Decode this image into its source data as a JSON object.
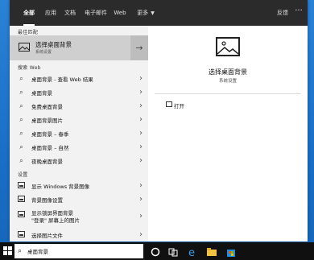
{
  "tabs": [
    {
      "label": "全部",
      "active": true
    },
    {
      "label": "应用",
      "active": false
    },
    {
      "label": "文档",
      "active": false
    },
    {
      "label": "电子邮件",
      "active": false
    },
    {
      "label": "Web",
      "active": false
    },
    {
      "label": "更多",
      "active": false
    }
  ],
  "more_caret": "▼",
  "feedback_label": "反馈",
  "more_options_icon": "···",
  "best_match": {
    "section_label": "最佳匹配",
    "title": "选择桌面背景",
    "subtitle": "系统设置",
    "arrow": "→"
  },
  "web_section": {
    "label": "搜索 Web",
    "items": [
      "桌面背景 - 查看 Web 结果",
      "桌面背景",
      "免费桌面背景",
      "桌面背景图片",
      "桌面背景 – 春季",
      "桌面背景 – 自然",
      "夜晚桌面背景"
    ]
  },
  "settings_section": {
    "label": "设置",
    "items": [
      "显示 Windows 背景图像",
      "背景图像设置",
      "显示锁屏界面背景",
      "选择图片文件"
    ],
    "wrapped_item": {
      "line1": "显示锁屏界面背景",
      "line2": "\"登录\" 屏幕上的图片"
    }
  },
  "right_panel": {
    "title": "选择桌面背景",
    "subtitle": "系统设置",
    "open_label": "打开"
  },
  "taskbar": {
    "search_text": "桌面背景",
    "search_glyph": "⌕"
  },
  "colors": {
    "accent": "#2b2b2b",
    "desktop": "#1a70c8",
    "best_match_bg": "#cfcfcf"
  }
}
